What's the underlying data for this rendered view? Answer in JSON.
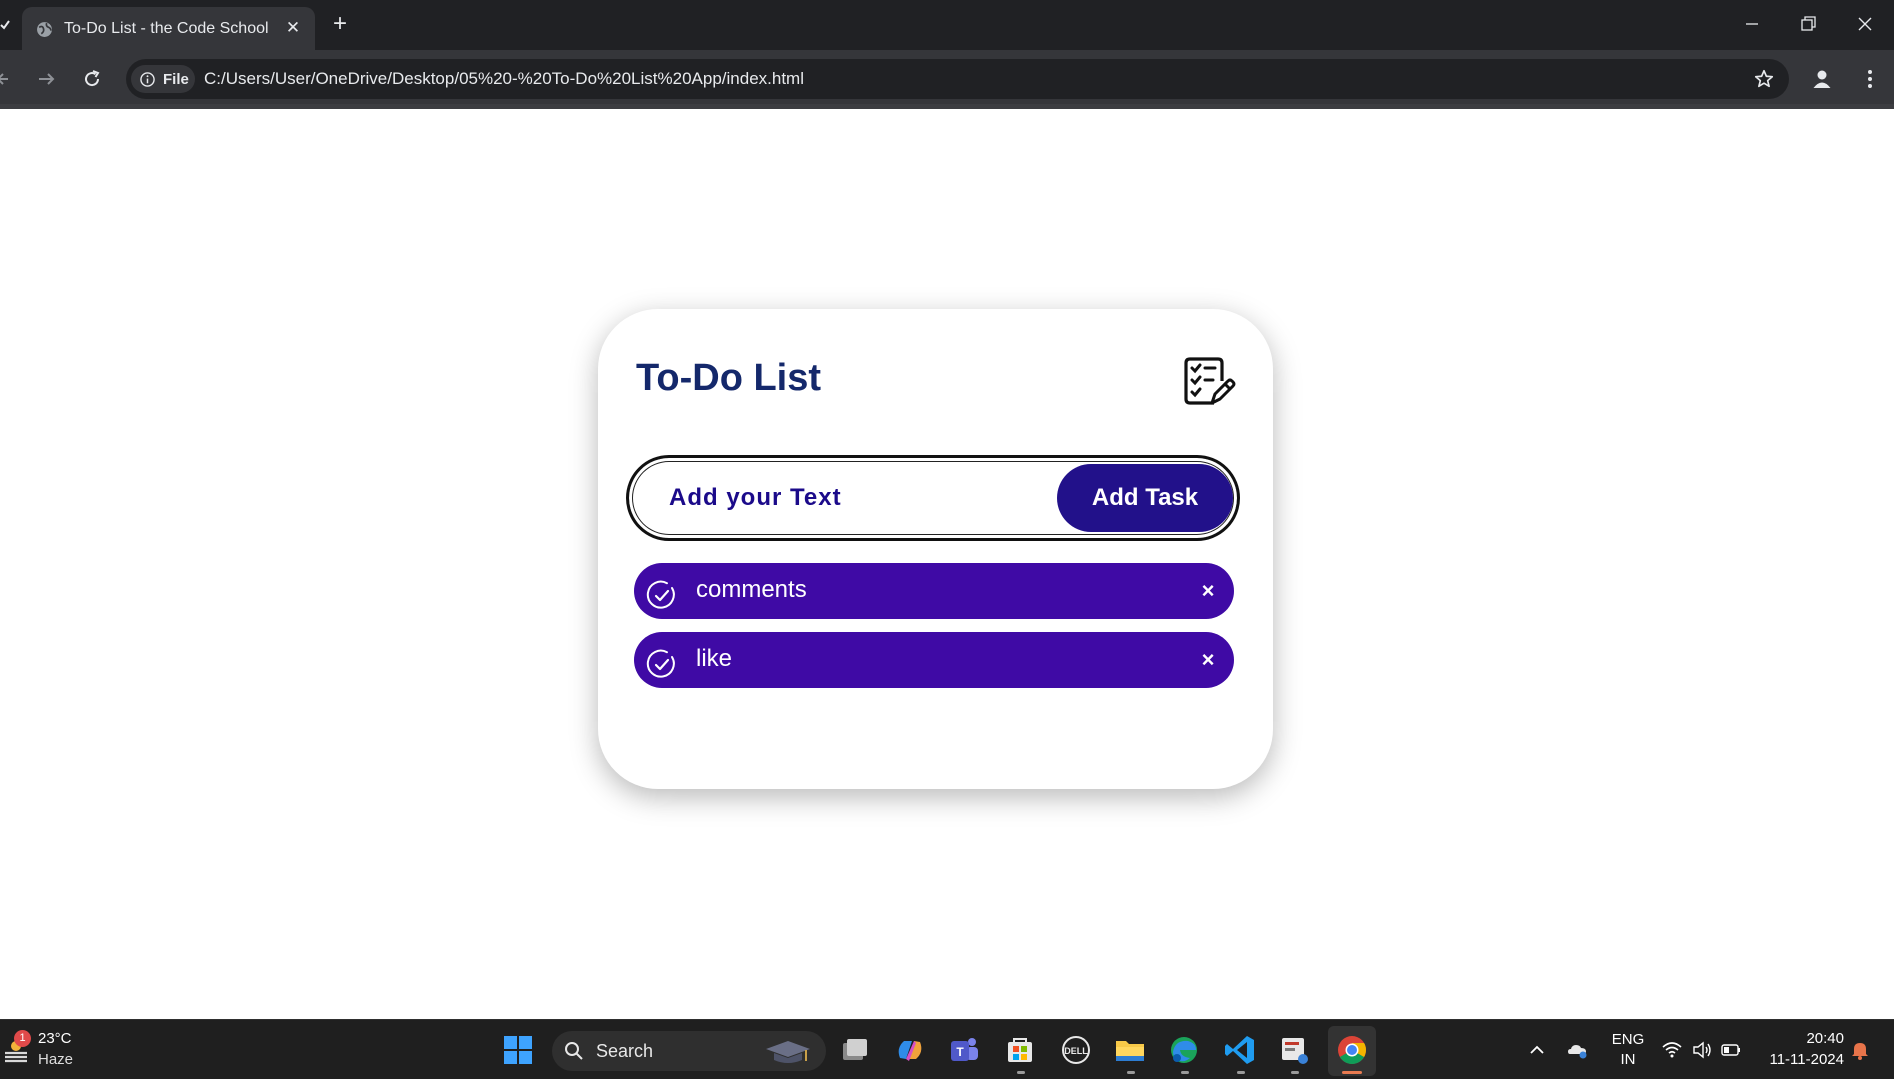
{
  "browser": {
    "tab_title": "To-Do List - the Code School",
    "new_tab_symbol": "+",
    "tab_close_symbol": "✕",
    "site_chip_label": "File",
    "url": "C:/Users/User/OneDrive/Desktop/05%20-%20To-Do%20List%20App/index.html"
  },
  "app": {
    "title": "To-Do List",
    "input_placeholder": "Add your Text",
    "add_button_label": "Add Task",
    "tasks": [
      {
        "text": "comments",
        "done": false
      },
      {
        "text": "like",
        "done": false
      }
    ],
    "delete_symbol": "×",
    "colors": {
      "title": "#14286b",
      "accent": "#22118a",
      "task_bg": "#3f0aa5"
    }
  },
  "taskbar": {
    "weather_temp": "23°C",
    "weather_desc": "Haze",
    "weather_badge": "1",
    "search_label": "Search",
    "lang_line1": "ENG",
    "lang_line2": "IN",
    "time": "20:40",
    "date": "11-11-2024"
  }
}
